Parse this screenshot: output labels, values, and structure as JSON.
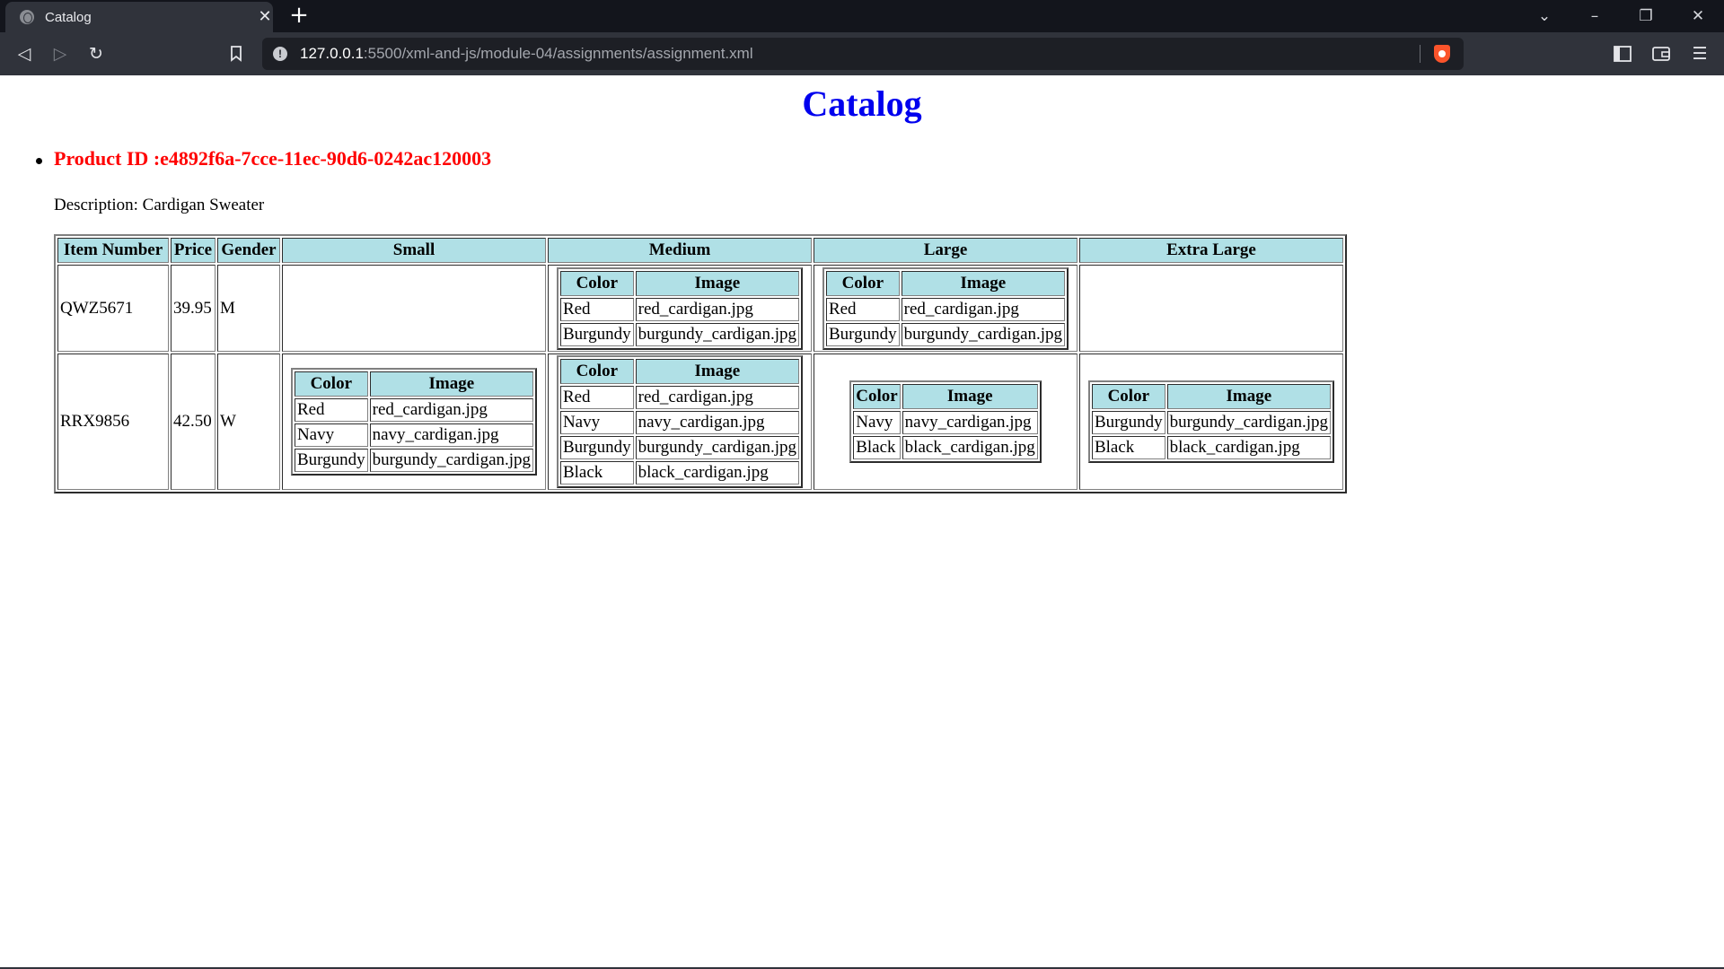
{
  "browser": {
    "tab_title": "Catalog",
    "tab_close_glyph": "✕",
    "new_tab_glyph": "+",
    "url_host": "127.0.0.1",
    "url_path": ":5500/xml-and-js/module-04/assignments/assignment.xml",
    "icons": {
      "favicon": "globe-icon",
      "back": "back-arrow-icon",
      "forward": "forward-arrow-icon",
      "reload": "reload-icon",
      "bookmark": "bookmark-icon",
      "site_info": "info-icon",
      "brave": "brave-lion-icon",
      "sidebar": "sidebar-icon",
      "wallet": "wallet-icon",
      "menu": "hamburger-menu-icon",
      "tab_search": "chevron-down-icon",
      "minimize": "minimize-icon",
      "restore": "restore-icon",
      "close": "close-icon"
    }
  },
  "page": {
    "heading": "Catalog",
    "product_id": "Product ID :e4892f6a-7cce-11ec-90d6-0242ac120003",
    "description": "Description: Cardigan Sweater",
    "colors": {
      "heading": "#0000ee",
      "product_id": "#ff0000",
      "header_bg": "#b0e0e6"
    }
  },
  "table": {
    "headers": [
      "Item Number",
      "Price",
      "Gender",
      "Small",
      "Medium",
      "Large",
      "Extra Large"
    ],
    "sub_headers": [
      "Color",
      "Image"
    ],
    "rows": [
      {
        "item_number": "QWZ5671",
        "price": "39.95",
        "gender": "M",
        "small": [],
        "medium": [
          {
            "color": "Red",
            "image": "red_cardigan.jpg"
          },
          {
            "color": "Burgundy",
            "image": "burgundy_cardigan.jpg"
          }
        ],
        "large": [
          {
            "color": "Red",
            "image": "red_cardigan.jpg"
          },
          {
            "color": "Burgundy",
            "image": "burgundy_cardigan.jpg"
          }
        ],
        "extra_large": []
      },
      {
        "item_number": "RRX9856",
        "price": "42.50",
        "gender": "W",
        "small": [
          {
            "color": "Red",
            "image": "red_cardigan.jpg"
          },
          {
            "color": "Navy",
            "image": "navy_cardigan.jpg"
          },
          {
            "color": "Burgundy",
            "image": "burgundy_cardigan.jpg"
          }
        ],
        "medium": [
          {
            "color": "Red",
            "image": "red_cardigan.jpg"
          },
          {
            "color": "Navy",
            "image": "navy_cardigan.jpg"
          },
          {
            "color": "Burgundy",
            "image": "burgundy_cardigan.jpg"
          },
          {
            "color": "Black",
            "image": "black_cardigan.jpg"
          }
        ],
        "large": [
          {
            "color": "Navy",
            "image": "navy_cardigan.jpg"
          },
          {
            "color": "Black",
            "image": "black_cardigan.jpg"
          }
        ],
        "extra_large": [
          {
            "color": "Burgundy",
            "image": "burgundy_cardigan.jpg"
          },
          {
            "color": "Black",
            "image": "black_cardigan.jpg"
          }
        ]
      }
    ]
  }
}
